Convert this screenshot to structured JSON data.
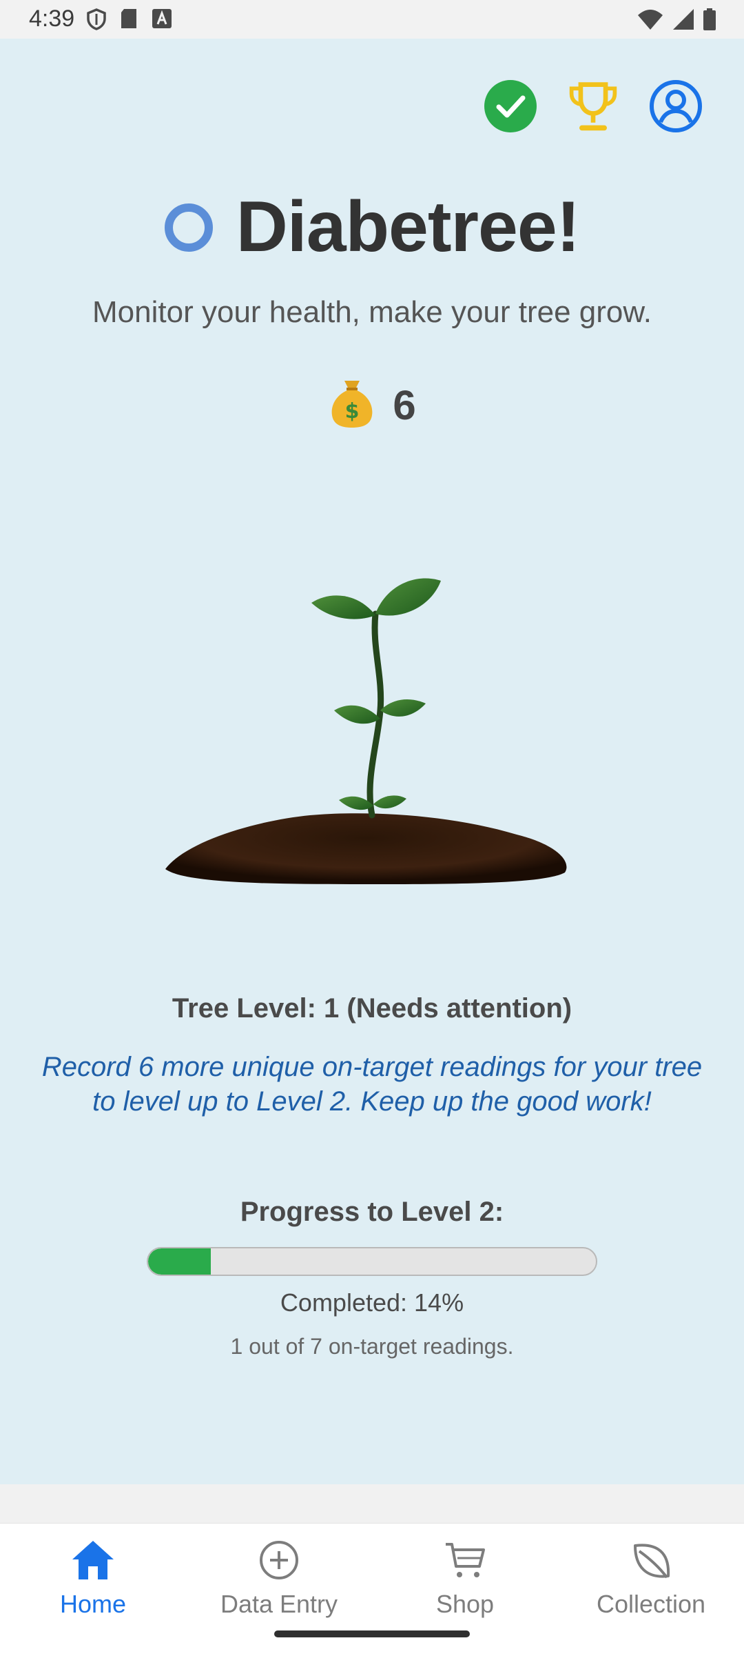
{
  "status_bar": {
    "time": "4:39",
    "left_icons": [
      "shield-icon",
      "sd-card-icon",
      "text-a-icon"
    ],
    "right_icons": [
      "wifi-icon",
      "cell-signal-icon",
      "battery-icon"
    ]
  },
  "header_icons": {
    "items": [
      "check-circle-icon",
      "trophy-icon",
      "account-icon"
    ],
    "colors": {
      "check": "#2aab4b",
      "trophy": "#f2c21b",
      "account": "#1a73e8"
    }
  },
  "app": {
    "title": "Diabetree!",
    "subtitle": "Monitor your health, make your tree grow.",
    "coin_icon": "money-bag-icon",
    "coins": "6"
  },
  "tree": {
    "level_text": "Tree Level: 1 (Needs attention)",
    "message": "Record 6 more unique on-target readings for your tree to level up to Level 2. Keep up the good work!"
  },
  "progress": {
    "title": "Progress to Level 2:",
    "percent": 14,
    "completed_text": "Completed: 14%",
    "readings_text": "1 out of 7 on-target readings.",
    "fill_color": "#2aab4b"
  },
  "nav": {
    "items": [
      {
        "label": "Home",
        "icon": "home-icon",
        "active": true
      },
      {
        "label": "Data Entry",
        "icon": "plus-circle-icon",
        "active": false
      },
      {
        "label": "Shop",
        "icon": "cart-icon",
        "active": false
      },
      {
        "label": "Collection",
        "icon": "leaf-icon",
        "active": false
      }
    ],
    "active_color": "#1a73e8"
  }
}
